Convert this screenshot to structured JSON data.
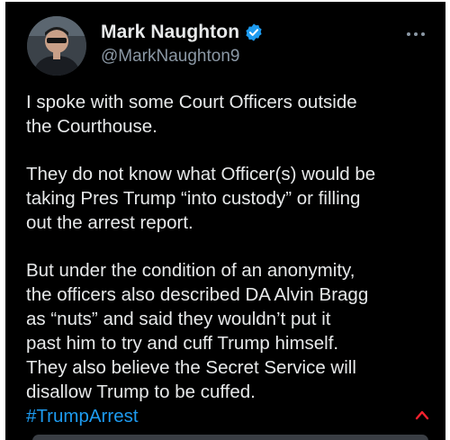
{
  "tweet": {
    "author": {
      "display_name": "Mark Naughton",
      "handle": "@MarkNaughton9"
    },
    "paragraphs": [
      "I spoke with some Court Officers outside\nthe Courthouse.",
      "They do not know what Officer(s) would be\ntaking Pres Trump “into custody” or filling\nout the arrest report.",
      "But under the condition of an anonymity,\nthe officers also described DA Alvin Bragg\nas “nuts” and said they wouldn’t put it\npast him to try and cuff Trump himself.\nThey also believe the Secret Service will\ndisallow Trump to be cuffed."
    ],
    "hashtag": "#TrumpArrest"
  },
  "colors": {
    "background": "#000000",
    "text": "#e7e9ea",
    "secondary_text": "#8b98a5",
    "accent": "#1d9bf0",
    "scroll_arrow": "#f4212e"
  },
  "icons": {
    "verified": "verified-badge-icon",
    "more": "more-options-icon",
    "scroll_up": "chevron-up-icon"
  }
}
